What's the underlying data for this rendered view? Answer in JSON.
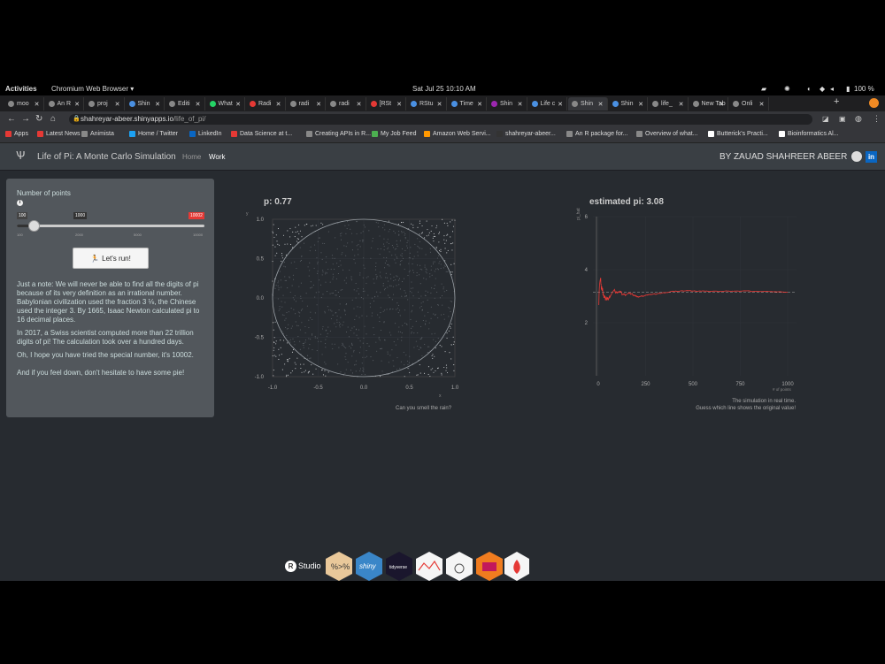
{
  "system": {
    "activities": "Activities",
    "app_menu": "Chromium Web Browser ▾",
    "clock": "Sat Jul 25  10:10 AM",
    "battery": "100 %"
  },
  "tabs": [
    {
      "label": "moo",
      "color": "#888"
    },
    {
      "label": "An R",
      "color": "#888"
    },
    {
      "label": "proj",
      "color": "#888"
    },
    {
      "label": "Shin",
      "color": "#4a90e2"
    },
    {
      "label": "Editi",
      "color": "#888"
    },
    {
      "label": "What",
      "color": "#25d366"
    },
    {
      "label": "Radi",
      "color": "#e53935"
    },
    {
      "label": "radi",
      "color": "#888"
    },
    {
      "label": "radi",
      "color": "#888"
    },
    {
      "label": "[RSt",
      "color": "#e53935"
    },
    {
      "label": "RStu",
      "color": "#4a90e2"
    },
    {
      "label": "Time",
      "color": "#4a90e2"
    },
    {
      "label": "Shin",
      "color": "#9c27b0"
    },
    {
      "label": "Life c",
      "color": "#4a90e2"
    },
    {
      "label": "Shin",
      "color": "#888",
      "active": true
    },
    {
      "label": "Shin",
      "color": "#4a90e2"
    },
    {
      "label": "life_",
      "color": "#888"
    },
    {
      "label": "New Tab",
      "color": "#888"
    },
    {
      "label": "Onli",
      "color": "#888"
    }
  ],
  "url": {
    "host": "shahreyar-abeer.shinyapps.io",
    "path": "/life_of_pi/"
  },
  "bookmarks": [
    {
      "label": "Apps",
      "color": "#e53935"
    },
    {
      "label": "Latest News",
      "color": "#e53935"
    },
    {
      "label": "Animista",
      "color": "#888"
    },
    {
      "label": "Home / Twitter",
      "color": "#1da1f2"
    },
    {
      "label": "LinkedIn",
      "color": "#0a66c2"
    },
    {
      "label": "Data Science at t...",
      "color": "#e53935"
    },
    {
      "label": "Creating APIs in R...",
      "color": "#888"
    },
    {
      "label": "My Job Feed",
      "color": "#4caf50"
    },
    {
      "label": "Amazon Web Servi...",
      "color": "#ff9800"
    },
    {
      "label": "shahreyar-abeer...",
      "color": "#333"
    },
    {
      "label": "An R package for...",
      "color": "#888"
    },
    {
      "label": "Overview of what...",
      "color": "#888"
    },
    {
      "label": "Butterick's Practi...",
      "color": "#fff"
    },
    {
      "label": "Bioinformatics Al...",
      "color": "#fff"
    }
  ],
  "navbar": {
    "title": "Life of Pi: A Monte Carlo Simulation",
    "home": "Home",
    "work": "Work",
    "author": "BY ZAUAD SHAHREER ABEER"
  },
  "sidebar": {
    "slider_label": "Number of points",
    "min": "100",
    "value": "1000",
    "max": "10002",
    "ticks": [
      "100",
      "2000",
      "5000",
      "10000"
    ],
    "value_fraction": 0.09,
    "run_label": "Let's run!",
    "paragraphs": [
      "Just a note: We will never be able to find all the digits of pi because of its very definition as an irrational number. Babylonian civilization used the fraction 3 ⅛, the Chinese used the integer 3. By 1665, Isaac Newton calculated pi to 16 decimal places.",
      "In 2017, a Swiss scientist computed more than 22 trillion digits of pi! The calculation took over a hundred days.",
      "Oh, I hope you have tried the special number, it's 10002.",
      "And if you feel down, don't hesitate to have some pie!"
    ]
  },
  "chart_data": [
    {
      "type": "scatter",
      "title": "p: 0.77",
      "xlabel": "x",
      "ylabel": "y",
      "xlim": [
        -1,
        1
      ],
      "ylim": [
        -1,
        1
      ],
      "xticks": [
        "-1.0",
        "-0.5",
        "0.0",
        "0.5",
        "1.0"
      ],
      "yticks": [
        "1.0",
        "0.5",
        "0.0",
        "-0.5",
        "-1.0"
      ],
      "points": 1000,
      "caption": "Can you smell the rain?"
    },
    {
      "type": "line",
      "title": "estimated pi: 3.08",
      "xlabel": "# of points",
      "ylabel": "pi_hat",
      "xlim": [
        0,
        1000
      ],
      "ylim": [
        0,
        6
      ],
      "xticks": [
        "0",
        "250",
        "500",
        "750",
        "1000"
      ],
      "yticks": [
        "6",
        "4",
        "2"
      ],
      "reference": 3.14159,
      "series_color": "#e53935",
      "caption": [
        "The simulation in real time.",
        "Guess which line shows the original value!"
      ]
    }
  ],
  "logos": [
    "Studio",
    "shiny",
    "tidyverse"
  ]
}
